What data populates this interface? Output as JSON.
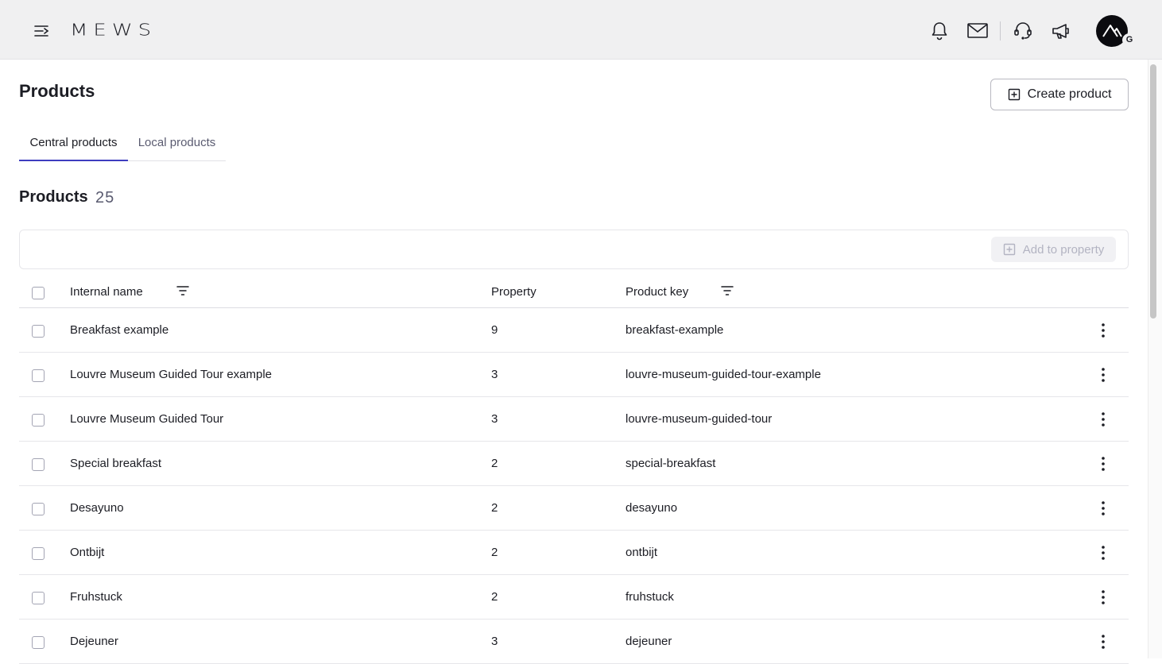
{
  "header": {
    "logo": "MEWS",
    "avatar_badge": "G",
    "icons": [
      "menu-icon",
      "bell-icon",
      "mail-icon",
      "support-icon",
      "megaphone-icon"
    ]
  },
  "page": {
    "title": "Products",
    "create_button": "Create product"
  },
  "tabs": [
    {
      "label": "Central products",
      "active": true
    },
    {
      "label": "Local products",
      "active": false
    }
  ],
  "section": {
    "title": "Products",
    "count": "25"
  },
  "toolbar": {
    "add_button": "Add to property"
  },
  "table": {
    "columns": [
      "Internal name",
      "Property",
      "Product key"
    ],
    "rows": [
      {
        "name": "Breakfast example",
        "property": "9",
        "key": "breakfast-example"
      },
      {
        "name": "Louvre Museum Guided Tour example",
        "property": "3",
        "key": "louvre-museum-guided-tour-example"
      },
      {
        "name": "Louvre Museum Guided Tour",
        "property": "3",
        "key": "louvre-museum-guided-tour"
      },
      {
        "name": "Special breakfast",
        "property": "2",
        "key": "special-breakfast"
      },
      {
        "name": "Desayuno",
        "property": "2",
        "key": "desayuno"
      },
      {
        "name": "Ontbijt",
        "property": "2",
        "key": "ontbijt"
      },
      {
        "name": "Fruhstuck",
        "property": "2",
        "key": "fruhstuck"
      },
      {
        "name": "Dejeuner",
        "property": "3",
        "key": "dejeuner"
      }
    ]
  },
  "colors": {
    "accent": "#3e3dbf",
    "topbar": "#f0f0f1",
    "text": "#1c1d24"
  }
}
